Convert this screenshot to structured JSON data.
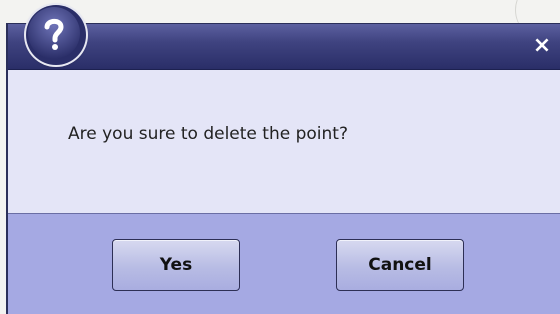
{
  "dialog": {
    "message": "Are you sure to delete the point?",
    "icon": "question-icon",
    "close_glyph": "×",
    "buttons": {
      "yes_label": "Yes",
      "cancel_label": "Cancel"
    }
  }
}
